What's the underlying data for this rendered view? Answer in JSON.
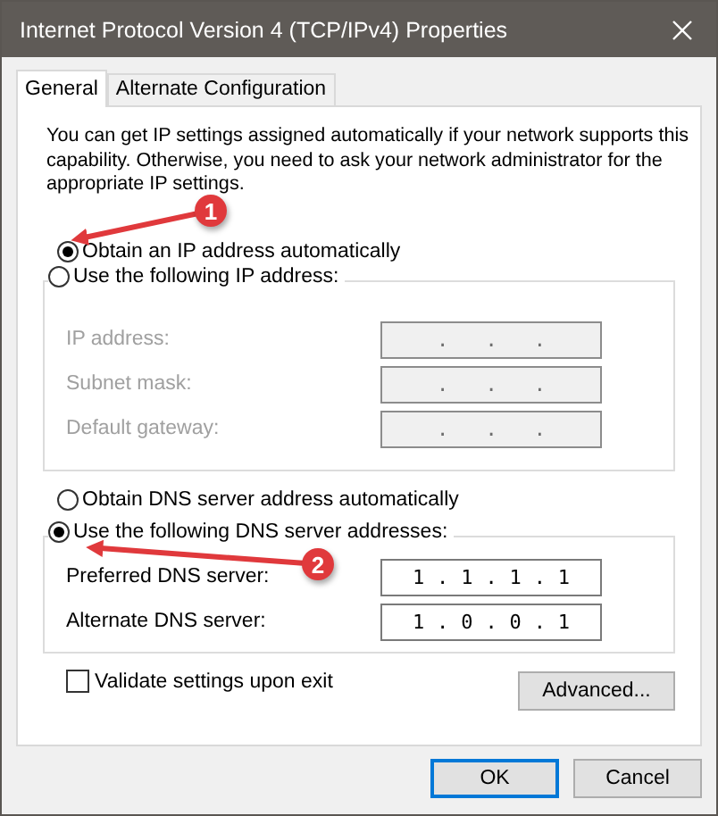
{
  "window": {
    "title": "Internet Protocol Version 4 (TCP/IPv4) Properties"
  },
  "tabs": [
    {
      "label": "General",
      "selected": true
    },
    {
      "label": "Alternate Configuration",
      "selected": false
    }
  ],
  "description": "You can get IP settings assigned automatically if your network supports this capability. Otherwise, you need to ask your network administrator for the appropriate IP settings.",
  "ip_mode": [
    {
      "label": "Obtain an IP address automatically",
      "selected": true
    },
    {
      "label": "Use the following IP address:",
      "selected": false
    }
  ],
  "separator": ".",
  "ip_fields": [
    {
      "label": "IP address:",
      "disabled": true
    },
    {
      "label": "Subnet mask:",
      "disabled": true
    },
    {
      "label": "Default gateway:",
      "disabled": true
    }
  ],
  "dns_mode": [
    {
      "label": "Obtain DNS server address automatically",
      "selected": false
    },
    {
      "label": "Use the following DNS server addresses:",
      "selected": true
    }
  ],
  "dns_fields": [
    {
      "label": "Preferred DNS server:",
      "disabled": false,
      "octets": [
        "1",
        "1",
        "1",
        "1"
      ]
    },
    {
      "label": "Alternate DNS server:",
      "disabled": false,
      "octets": [
        "1",
        "0",
        "0",
        "1"
      ]
    }
  ],
  "validate": {
    "label": "Validate settings upon exit",
    "checked": false
  },
  "advanced_button": "Advanced...",
  "buttons": [
    {
      "label": "OK",
      "default": true
    },
    {
      "label": "Cancel",
      "default": false
    }
  ],
  "annotations": [
    {
      "label": "1"
    },
    {
      "label": "2"
    }
  ]
}
